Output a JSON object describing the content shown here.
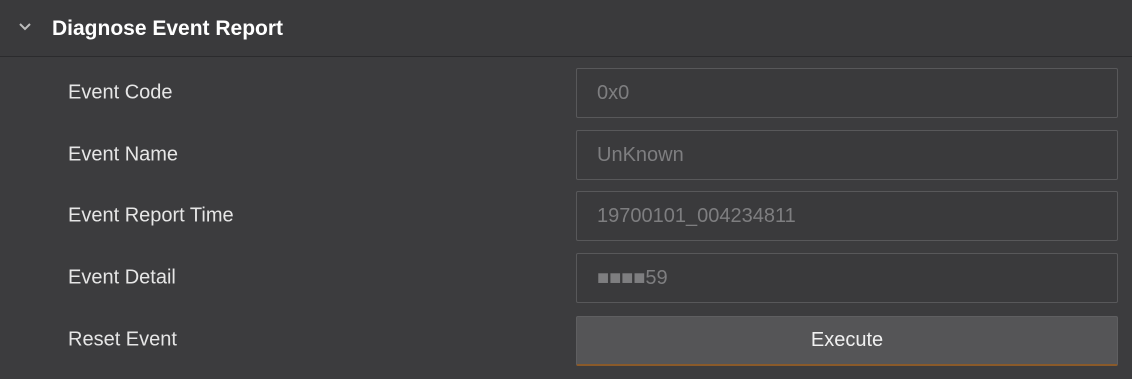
{
  "section": {
    "title": "Diagnose Event Report",
    "expand_icon": "chevron-down-icon"
  },
  "rows": [
    {
      "label": "Event Code",
      "value": "0x0"
    },
    {
      "label": "Event Name",
      "value": "UnKnown"
    },
    {
      "label": "Event Report Time",
      "value": "19700101_004234811"
    },
    {
      "label": "Event Detail",
      "value": "■■■■59"
    },
    {
      "label": "Reset Event",
      "button": "Execute"
    }
  ],
  "colors": {
    "panel_bg": "#3c3c3e",
    "field_border": "#58585a",
    "field_text": "#7e7e80",
    "button_bg": "#555557",
    "button_accent": "#8a5a2a"
  }
}
